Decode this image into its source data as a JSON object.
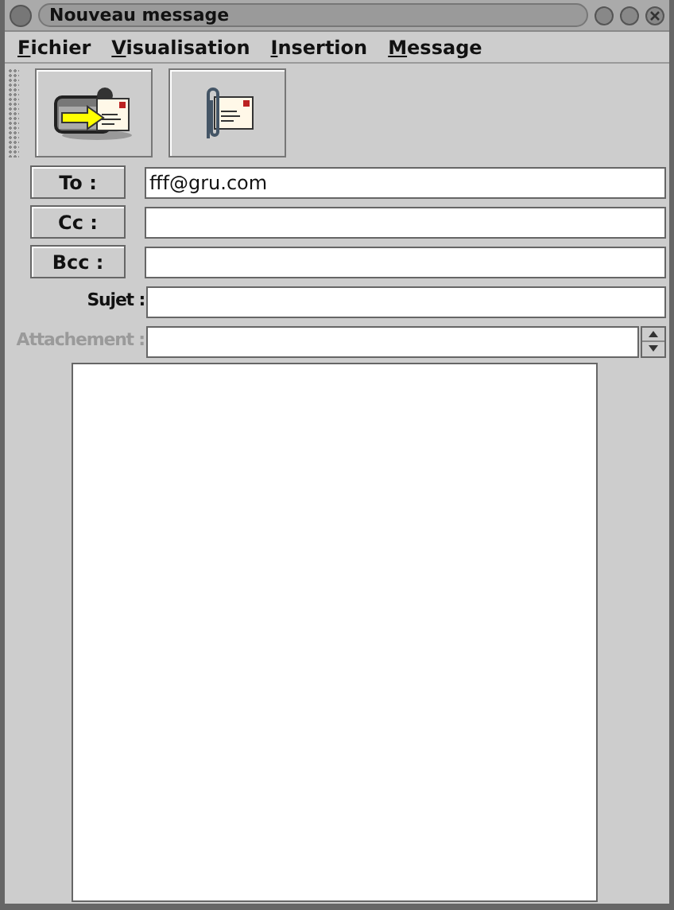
{
  "window": {
    "title": "Nouveau message"
  },
  "menu": [
    {
      "label": "Fichier"
    },
    {
      "label": "Visualisation"
    },
    {
      "label": "Insertion"
    },
    {
      "label": "Message"
    }
  ],
  "toolbar": [
    {
      "kind": "send"
    },
    {
      "kind": "attach"
    }
  ],
  "fields": [
    {
      "kind": "button",
      "label": "To :",
      "value": "fff@gru.com",
      "disabled": false
    },
    {
      "kind": "button",
      "label": "Cc :",
      "disabled": false
    },
    {
      "kind": "button",
      "label": "Bcc :",
      "disabled": false
    },
    {
      "kind": "label",
      "label": "Sujet :",
      "disabled": false
    },
    {
      "kind": "spinner",
      "label": "Attachement :",
      "disabled": true
    }
  ]
}
